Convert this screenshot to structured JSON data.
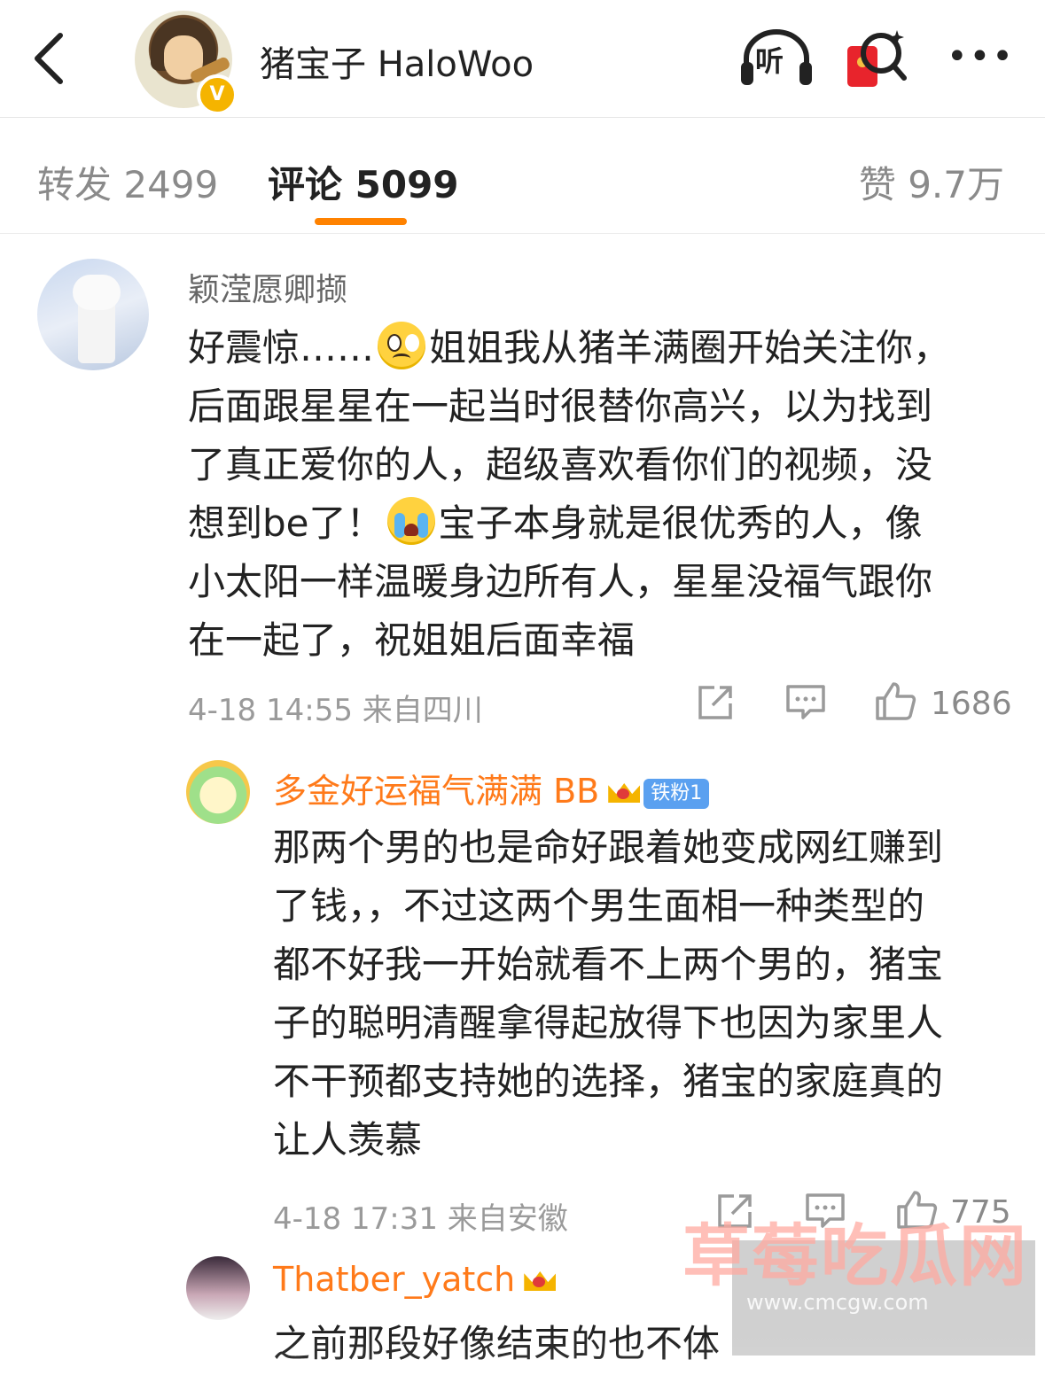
{
  "header": {
    "title": "猪宝子 HaloWoo",
    "verified_badge": "V",
    "listen_label": "听",
    "more_label": "•••",
    "icons": [
      "back-icon",
      "headphones-icon",
      "red-packet-search-icon",
      "more-icon"
    ]
  },
  "tabs": {
    "repost": "转发 2499",
    "comment": "评论 5099",
    "like": "赞 9.7万"
  },
  "comment": {
    "username": "颖滢愿卿撷",
    "lines": [
      {
        "pre": "好震惊……",
        "emoji": "sad-face",
        "post": "姐姐我从猪羊满圈开始关注你，"
      },
      {
        "pre": "后面跟星星在一起当时很替你高兴，以为找到"
      },
      {
        "pre": "了真正爱你的人，超级喜欢看你们的视频，没"
      },
      {
        "pre": "想到be了！",
        "emoji": "crying-face",
        "post": "宝子本身就是很优秀的人，像"
      },
      {
        "pre": "小太阳一样温暖身边所有人，星星没福气跟你"
      },
      {
        "pre": "在一起了，祝姐姐后面幸福"
      }
    ],
    "meta": "4-18 14:55 来自四川",
    "like_count": "1686"
  },
  "replies": [
    {
      "username": "多金好运福气满满 BB",
      "badge": "铁粉1",
      "lines": [
        "那两个男的也是命好跟着她变成网红赚到",
        "了钱，，不过这两个男生面相一种类型的",
        "都不好我一开始就看不上两个男的，猪宝",
        "子的聪明清醒拿得起放得下也因为家里人",
        "不干预都支持她的选择，猪宝的家庭真的",
        "让人羡慕"
      ],
      "meta": "4-18 17:31 来自安徽",
      "like_count": "775"
    },
    {
      "username": "Thatber_yatch",
      "lines": [
        "之前那段好像结束的也不体"
      ]
    }
  ],
  "watermark": {
    "text": "草莓吃瓜网",
    "url": "www.cmcgw.com"
  },
  "colors": {
    "accent": "#ff8200",
    "reply_name": "#ff7a1a",
    "meta_gray": "#9a9a9a",
    "fan_badge": "#5aa0f0"
  }
}
